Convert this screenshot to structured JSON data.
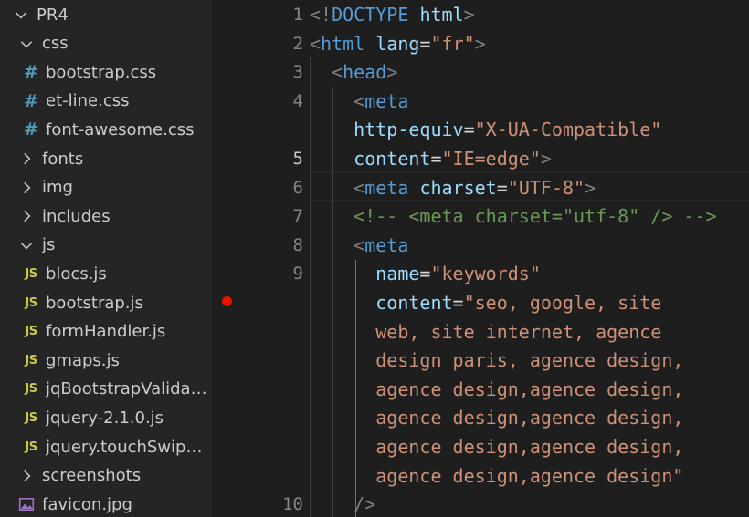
{
  "explorer": {
    "items": [
      {
        "label": "PR4",
        "kind": "folder-open",
        "depth": 0
      },
      {
        "label": "css",
        "kind": "folder-open",
        "depth": 1
      },
      {
        "label": "bootstrap.css",
        "kind": "css",
        "depth": 2
      },
      {
        "label": "et-line.css",
        "kind": "css",
        "depth": 2
      },
      {
        "label": "font-awesome.css",
        "kind": "css",
        "depth": 2
      },
      {
        "label": "fonts",
        "kind": "folder-closed",
        "depth": 1
      },
      {
        "label": "img",
        "kind": "folder-closed",
        "depth": 1
      },
      {
        "label": "includes",
        "kind": "folder-closed",
        "depth": 1
      },
      {
        "label": "js",
        "kind": "folder-open",
        "depth": 1
      },
      {
        "label": "blocs.js",
        "kind": "js",
        "depth": 2
      },
      {
        "label": "bootstrap.js",
        "kind": "js",
        "depth": 2
      },
      {
        "label": "formHandler.js",
        "kind": "js",
        "depth": 2
      },
      {
        "label": "gmaps.js",
        "kind": "js",
        "depth": 2
      },
      {
        "label": "jqBootstrapValidatio...",
        "kind": "js",
        "depth": 2
      },
      {
        "label": "jquery-2.1.0.js",
        "kind": "js",
        "depth": 2
      },
      {
        "label": "jquery.touchSwipe.js",
        "kind": "js",
        "depth": 2
      },
      {
        "label": "screenshots",
        "kind": "folder-closed",
        "depth": 1
      },
      {
        "label": "favicon.jpg",
        "kind": "image",
        "depth": 1
      }
    ],
    "icons": {
      "css": "#",
      "js": "JS",
      "folder_open": "chevron-down-icon",
      "folder_closed": "chevron-right-icon",
      "image": "image-file-icon"
    }
  },
  "editor": {
    "line_numbers": [
      "1",
      "2",
      "3",
      "4",
      "",
      "5",
      "6",
      "7",
      "8",
      "9",
      "",
      "",
      "",
      "",
      "",
      "",
      "",
      "10"
    ],
    "active_line": "5",
    "breakpoint_line": "9",
    "code_lines": [
      [
        [
          "br",
          "<!"
        ],
        [
          "tag",
          "DOCTYPE"
        ],
        [
          "eq",
          " "
        ],
        [
          "att",
          "html"
        ],
        [
          "br",
          ">"
        ]
      ],
      [
        [
          "br",
          "<"
        ],
        [
          "tag",
          "html"
        ],
        [
          "eq",
          " "
        ],
        [
          "att",
          "lang"
        ],
        [
          "eq",
          "="
        ],
        [
          "str",
          "\"fr\""
        ],
        [
          "br",
          ">"
        ]
      ],
      [
        [
          "eq",
          "  "
        ],
        [
          "br",
          "<"
        ],
        [
          "tag",
          "head"
        ],
        [
          "br",
          ">"
        ]
      ],
      [
        [
          "eq",
          "    "
        ],
        [
          "br",
          "<"
        ],
        [
          "tag",
          "meta"
        ]
      ],
      [
        [
          "eq",
          "    "
        ],
        [
          "att",
          "http-equiv"
        ],
        [
          "eq",
          "="
        ],
        [
          "str",
          "\"X-UA-Compatible\""
        ]
      ],
      [
        [
          "eq",
          "    "
        ],
        [
          "att",
          "content"
        ],
        [
          "eq",
          "="
        ],
        [
          "str",
          "\"IE=edge\""
        ],
        [
          "br",
          ">"
        ]
      ],
      [
        [
          "eq",
          "    "
        ],
        [
          "br",
          "<"
        ],
        [
          "tag",
          "meta"
        ],
        [
          "eq",
          " "
        ],
        [
          "att",
          "charset"
        ],
        [
          "eq",
          "="
        ],
        [
          "str",
          "\"UTF-8\""
        ],
        [
          "br",
          ">"
        ]
      ],
      [
        [
          "eq",
          "    "
        ],
        [
          "cmt",
          "<!-- <meta charset=\"utf-8\" /> -->"
        ]
      ],
      [
        [
          "eq",
          "    "
        ],
        [
          "br",
          "<"
        ],
        [
          "tag",
          "meta"
        ]
      ],
      [
        [
          "eq",
          "      "
        ],
        [
          "att",
          "name"
        ],
        [
          "eq",
          "="
        ],
        [
          "str",
          "\"keywords\""
        ]
      ],
      [
        [
          "eq",
          "      "
        ],
        [
          "att",
          "content"
        ],
        [
          "eq",
          "="
        ],
        [
          "str",
          "\"seo, google, site"
        ]
      ],
      [
        [
          "str",
          "      web, site internet, agence"
        ]
      ],
      [
        [
          "str",
          "      design paris, agence design,"
        ]
      ],
      [
        [
          "str",
          "      agence design,agence design,"
        ]
      ],
      [
        [
          "str",
          "      agence design,agence design,"
        ]
      ],
      [
        [
          "str",
          "      agence design,agence design,"
        ]
      ],
      [
        [
          "str",
          "      agence design,agence design\""
        ]
      ],
      [
        [
          "eq",
          "    "
        ],
        [
          "br",
          "/>"
        ]
      ]
    ]
  },
  "colors": {
    "background": "#1e1e1e",
    "sidebar": "#252526",
    "tag": "#569cd6",
    "attribute": "#9cdcfe",
    "string": "#ce9178",
    "comment": "#6a9955",
    "bracket": "#808080",
    "breakpoint": "#e51400",
    "css_icon": "#519aba",
    "js_icon": "#cbcb41"
  }
}
